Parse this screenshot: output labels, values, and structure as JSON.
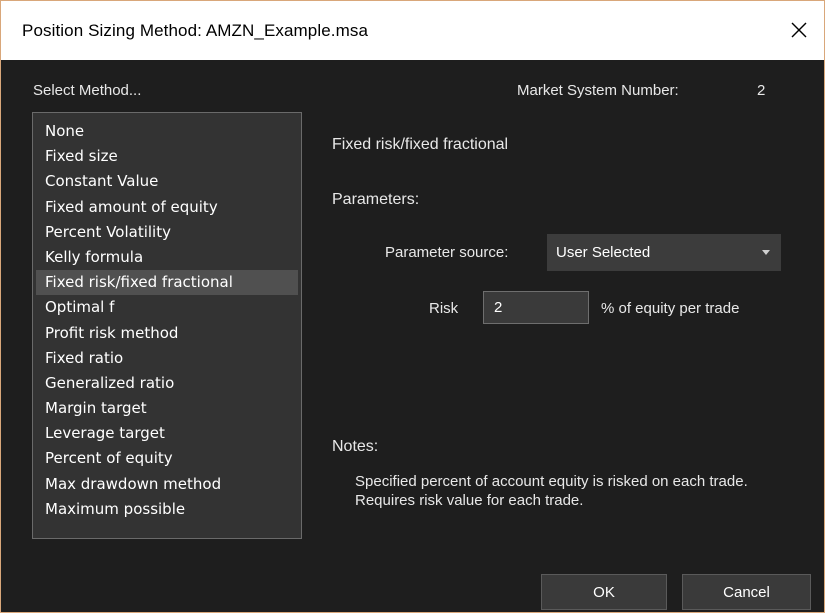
{
  "window": {
    "title": "Position Sizing Method: AMZN_Example.msa",
    "close_icon": "close-icon"
  },
  "header": {
    "select_label": "Select Method...",
    "market_system_label": "Market System Number:",
    "market_system_value": "2"
  },
  "methods": [
    "None",
    "Fixed size",
    "Constant Value",
    "Fixed amount of equity",
    "Percent Volatility",
    "Kelly formula",
    "Fixed risk/fixed fractional",
    "Optimal f",
    "Profit risk method",
    "Fixed ratio",
    "Generalized ratio",
    "Margin target",
    "Leverage target",
    "Percent of equity",
    "Max drawdown method",
    "Maximum possible"
  ],
  "selected_method_index": 6,
  "details": {
    "method_title": "Fixed risk/fixed fractional",
    "parameters_label": "Parameters:",
    "parameter_source_label": "Parameter source:",
    "parameter_source_value": "User Selected",
    "risk_label": "Risk",
    "risk_value": "2",
    "risk_suffix": "% of equity per trade",
    "notes_label": "Notes:",
    "notes_text": "Specified percent of account equity is risked on each trade. Requires risk value for each trade."
  },
  "buttons": {
    "ok": "OK",
    "cancel": "Cancel"
  },
  "colors": {
    "background": "#1e1e1e",
    "list_background": "#333333",
    "selected_item": "#505050",
    "title_bar": "#ffffff"
  }
}
